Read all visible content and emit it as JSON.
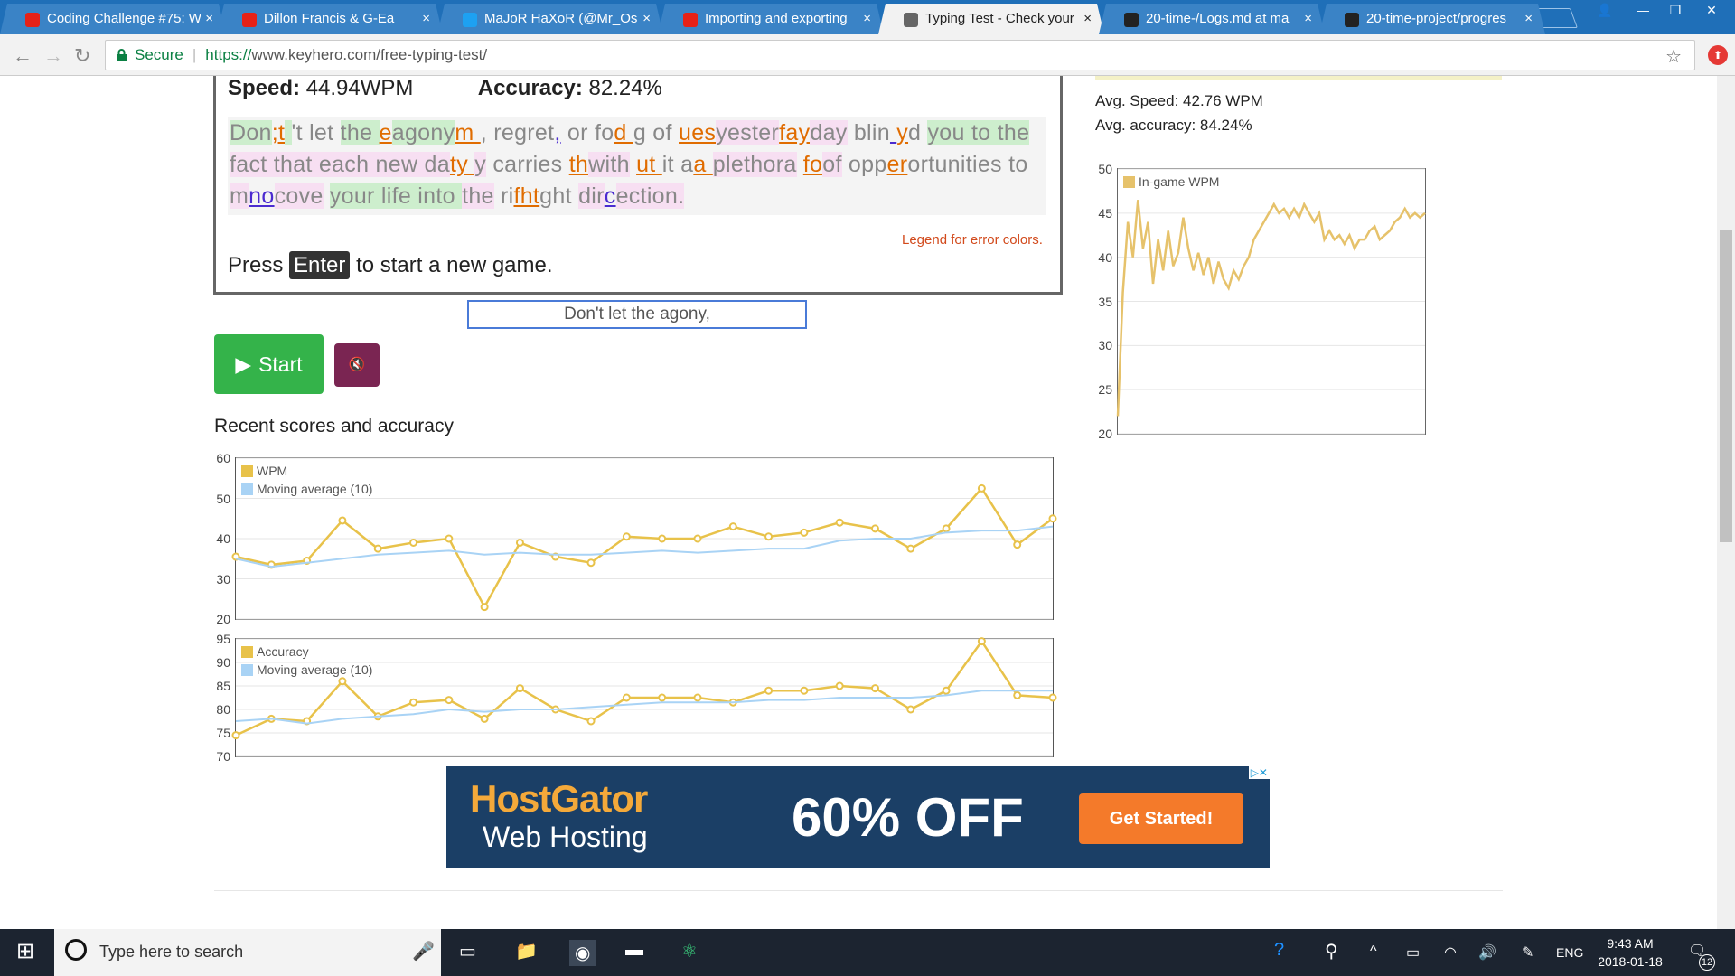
{
  "tabs": [
    {
      "title": "Coding Challenge #75: W",
      "icon": "youtube-icon",
      "color": "#e62117"
    },
    {
      "title": "Dillon Francis & G-Ea",
      "icon": "youtube-icon",
      "color": "#e62117"
    },
    {
      "title": "MaJoR HaXoR (@Mr_Os",
      "icon": "twitter-icon",
      "color": "#1da1f2"
    },
    {
      "title": "Importing and exporting",
      "icon": "youtube-icon",
      "color": "#e62117"
    },
    {
      "title": "Typing Test - Check your",
      "icon": "keyhero-icon",
      "color": "#666666"
    },
    {
      "title": "20-time-/Logs.md at ma",
      "icon": "github-icon",
      "color": "#222222"
    },
    {
      "title": "20-time-project/progres",
      "icon": "github-icon",
      "color": "#222222"
    }
  ],
  "address": {
    "secure_label": "Secure",
    "url_scheme": "https://",
    "url_host": "www.keyhero.com",
    "url_path": "/free-typing-test/"
  },
  "game": {
    "speed_label": "Speed:",
    "speed_value": "44.94WPM",
    "accuracy_label": "Accuracy:",
    "accuracy_value": "82.24%",
    "legend_link": "Legend for error colors.",
    "press_pre": "Press",
    "press_key": "Enter",
    "press_post": "to start a new game.",
    "typed_value": "Don't let the agony,"
  },
  "buttons": {
    "start_label": "Start",
    "mute_label": "🔇"
  },
  "recent": {
    "title": "Recent scores and accuracy"
  },
  "sidebar": {
    "avg_speed": "Avg. Speed: 42.76 WPM",
    "avg_accuracy": "Avg. accuracy: 84.24%"
  },
  "ad": {
    "brand": "HostGator",
    "tagline": "Web Hosting",
    "offer": "60% OFF",
    "cta": "Get Started!"
  },
  "taskbar": {
    "search_placeholder": "Type here to search",
    "lang": "ENG",
    "time": "9:43 AM",
    "date": "2018-01-18",
    "notif_count": "12"
  },
  "chart_data": [
    {
      "type": "line",
      "title": "",
      "legend": [
        "WPM",
        "Moving average (10)"
      ],
      "ylim": [
        20,
        60
      ],
      "yticks": [
        20,
        30,
        40,
        50,
        60
      ],
      "x": [
        1,
        2,
        3,
        4,
        5,
        6,
        7,
        8,
        9,
        10,
        11,
        12,
        13,
        14,
        15,
        16,
        17,
        18,
        19,
        20,
        21,
        22,
        23,
        24
      ],
      "series": [
        {
          "name": "WPM",
          "color": "#e8c24a",
          "values": [
            35.5,
            33.5,
            34.5,
            44.5,
            37.5,
            39,
            40,
            23,
            39,
            35.5,
            34,
            40.5,
            40,
            40,
            43,
            40.5,
            41.5,
            44,
            42.5,
            37.5,
            42.5,
            52.5,
            38.5,
            45
          ]
        },
        {
          "name": "Moving average (10)",
          "color": "#a9d3f5",
          "values": [
            35,
            33,
            34,
            35,
            36,
            36.5,
            37,
            36,
            36.5,
            36,
            36,
            36.5,
            37,
            36.5,
            37,
            37.5,
            37.5,
            39.5,
            40,
            40,
            41.5,
            42,
            42,
            43
          ]
        }
      ]
    },
    {
      "type": "line",
      "title": "",
      "legend": [
        "Accuracy",
        "Moving average (10)"
      ],
      "ylim": [
        70,
        95
      ],
      "yticks": [
        70,
        75,
        80,
        85,
        90,
        95
      ],
      "x": [
        1,
        2,
        3,
        4,
        5,
        6,
        7,
        8,
        9,
        10,
        11,
        12,
        13,
        14,
        15,
        16,
        17,
        18,
        19,
        20,
        21,
        22,
        23,
        24
      ],
      "series": [
        {
          "name": "Accuracy",
          "color": "#e8c24a",
          "values": [
            74.5,
            78,
            77.5,
            86,
            78.5,
            81.5,
            82,
            78,
            84.5,
            80,
            77.5,
            82.5,
            82.5,
            82.5,
            81.5,
            84,
            84,
            85,
            84.5,
            80,
            84,
            94.5,
            83,
            82.5
          ]
        },
        {
          "name": "Moving average (10)",
          "color": "#a9d3f5",
          "values": [
            77.5,
            78,
            77,
            78,
            78.5,
            79,
            80,
            79.5,
            80,
            80,
            80.5,
            81,
            81.5,
            81.5,
            81.5,
            82,
            82,
            82.5,
            82.5,
            82.5,
            83,
            84,
            84,
            84
          ]
        }
      ]
    },
    {
      "type": "line",
      "title": "",
      "legend": [
        "In-game WPM"
      ],
      "ylim": [
        20,
        50
      ],
      "yticks": [
        20,
        25,
        30,
        35,
        40,
        45,
        50
      ],
      "series": [
        {
          "name": "In-game WPM",
          "color": "#e6c26b",
          "values": [
            22,
            36,
            44,
            40,
            46.5,
            41,
            44,
            37,
            42,
            38.5,
            43,
            39,
            40.5,
            44.5,
            41,
            38.5,
            40.5,
            38,
            40,
            37,
            39.5,
            37.5,
            36.5,
            38.5,
            37.5,
            39,
            40,
            42,
            43,
            44,
            45,
            46,
            45,
            45.5,
            44.5,
            45.5,
            44.5,
            46,
            45,
            44,
            45,
            42,
            43,
            42,
            42.5,
            41.5,
            42.5,
            41,
            42,
            42,
            43,
            43.5,
            42,
            42.5,
            43,
            44,
            44.5,
            45.5,
            44.5,
            45,
            44.5,
            45
          ]
        }
      ]
    }
  ]
}
